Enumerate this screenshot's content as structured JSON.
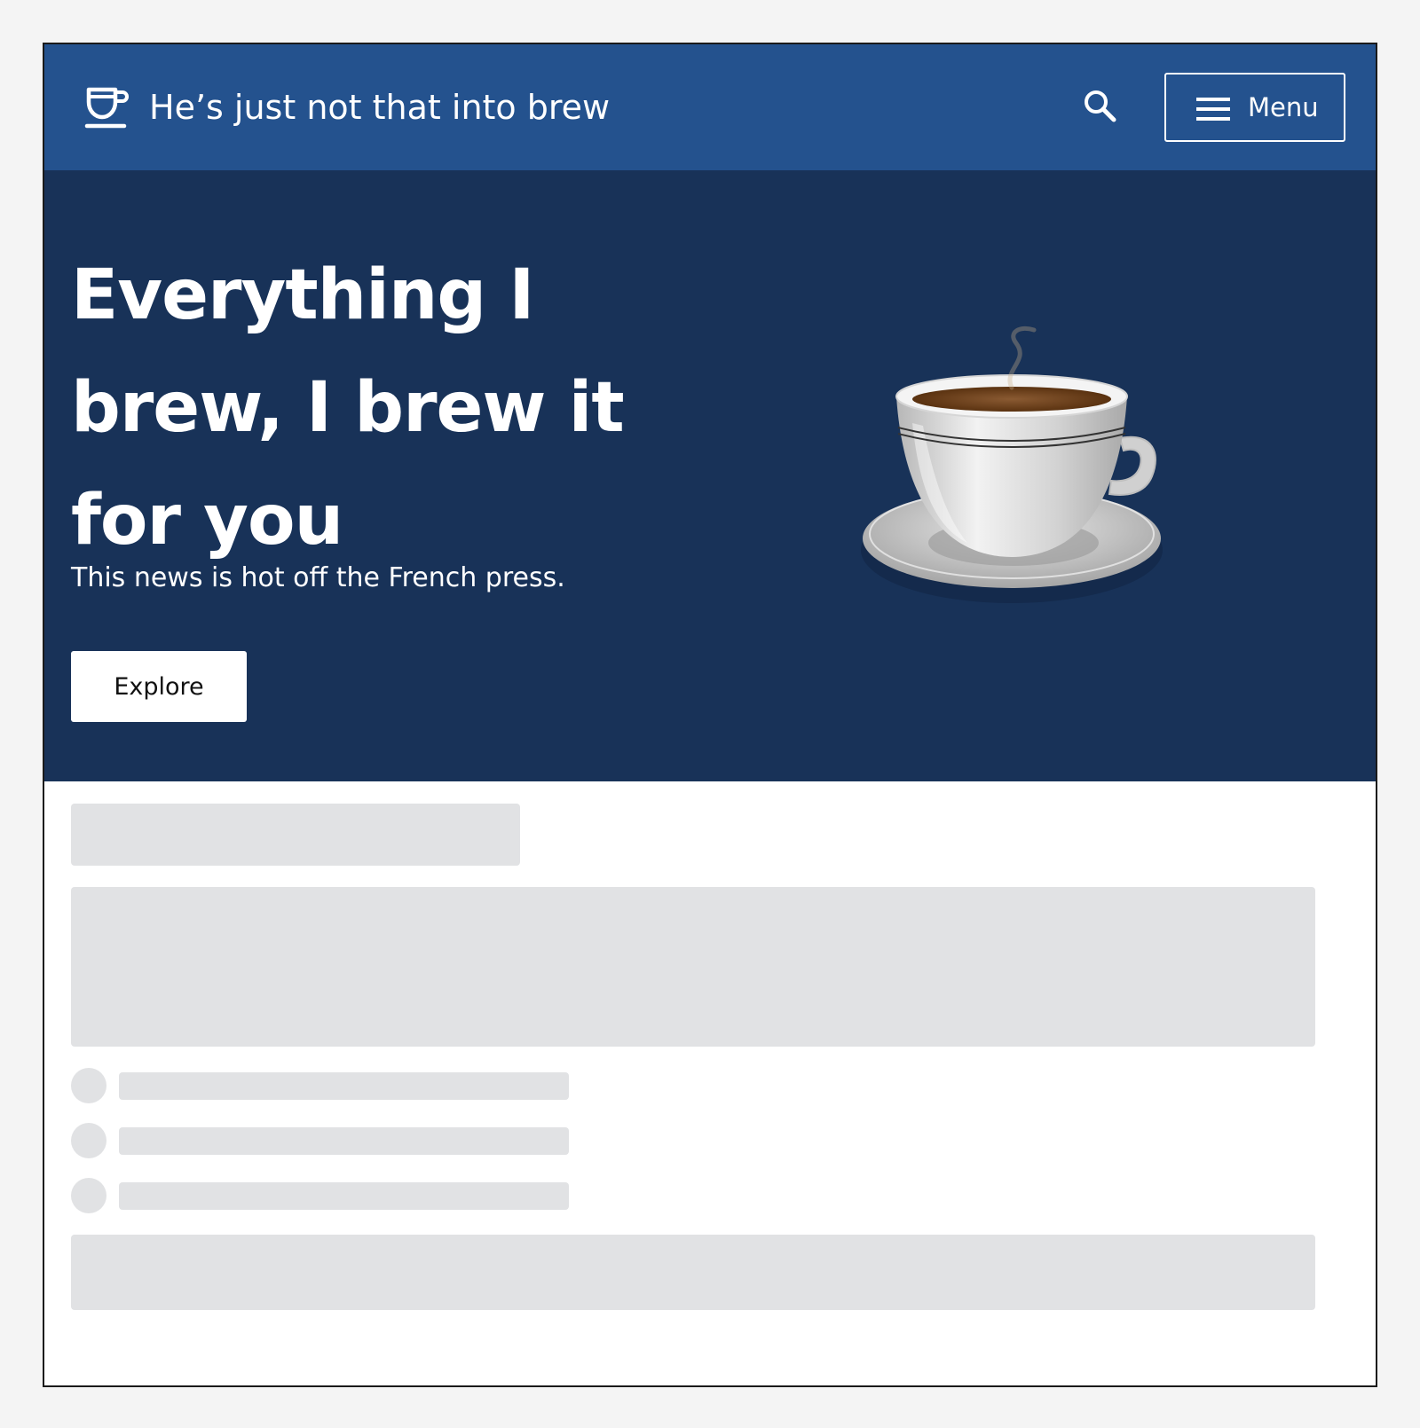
{
  "header": {
    "site_title": "He’s just not that into brew",
    "logo_icon": "coffee-cup-icon",
    "search_icon": "search-icon",
    "menu_icon": "hamburger-menu-icon",
    "menu_label": "Menu",
    "background": "#24528e"
  },
  "hero": {
    "title": "Everything I brew, I brew it for you",
    "subtitle": "This news is hot off the French press.",
    "cta_label": "Explore",
    "image": "coffee-cup-with-saucer",
    "background": "#183258"
  },
  "content": {
    "state": "loading-skeleton",
    "list_placeholder_count": 3,
    "skeleton_color": "#e1e2e4"
  }
}
